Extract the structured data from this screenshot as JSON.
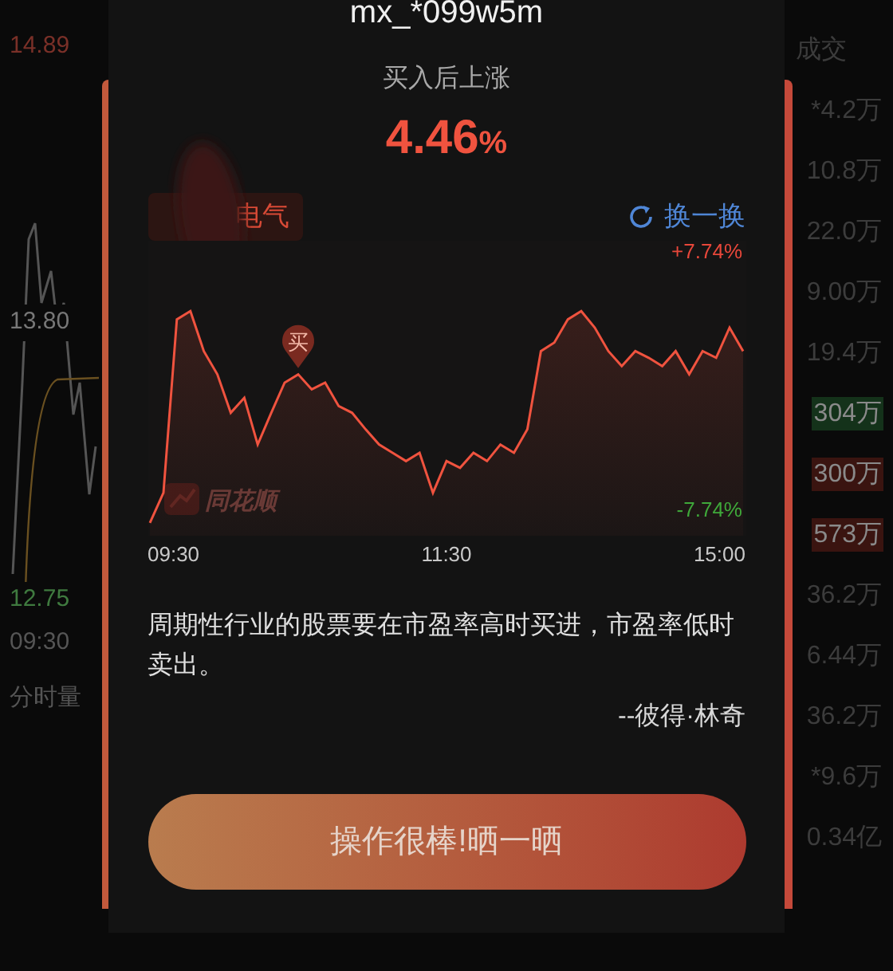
{
  "background": {
    "left_labels": [
      {
        "text": "14.89",
        "kind": "up"
      },
      {
        "text": "13.80",
        "kind": "flat"
      },
      {
        "text": "12.75",
        "kind": "down"
      },
      {
        "text": "09:30",
        "kind": "time"
      },
      {
        "text": "分时量",
        "kind": "section"
      }
    ],
    "volume_header": "成交",
    "volumes": [
      {
        "text": "*4.2万"
      },
      {
        "text": "10.8万"
      },
      {
        "text": "22.0万"
      },
      {
        "text": "9.00万"
      },
      {
        "text": "19.4万"
      },
      {
        "text": "304万",
        "color": "#14321a"
      },
      {
        "text": "300万",
        "color": "#3a1410"
      },
      {
        "text": "573万",
        "color": "#3a1410"
      },
      {
        "text": "36.2万"
      },
      {
        "text": "6.44万"
      },
      {
        "text": "36.2万"
      },
      {
        "text": "*9.6万"
      },
      {
        "text": "0.34亿"
      }
    ]
  },
  "dialog": {
    "user": "mx_*099w5m",
    "gain_label": "买入后上涨",
    "gain_value": "4.46",
    "gain_unit": "%",
    "stock_tag": "电气",
    "refresh": "换一换",
    "chart_data": {
      "type": "line",
      "series": [
        {
          "color": "#f0533f",
          "values": [
            -8.5,
            -6.7,
            3.7,
            4.2,
            1.8,
            0.4,
            -1.9,
            -1,
            -3.8,
            -1.9,
            -0.1,
            0.4,
            -0.5,
            -0.1,
            -1.5,
            -1.9,
            -2.9,
            -3.8,
            -4.3,
            -4.8,
            -4.3,
            -6.7,
            -4.8,
            -5.2,
            -4.3,
            -4.8,
            -3.8,
            -4.3,
            -2.9,
            1.8,
            2.3,
            3.7,
            4.2,
            3.2,
            1.8,
            0.9,
            1.8,
            1.4,
            0.9,
            1.8,
            0.4,
            1.8,
            1.4,
            3.2,
            1.8
          ]
        }
      ],
      "ylim": [
        -9.27,
        8.41
      ],
      "yticks": [
        {
          "value": 7.74,
          "label": "+7.74%"
        },
        {
          "value": -7.74,
          "label": "-7.74%"
        }
      ]
    },
    "time_labels": [
      "09:30",
      "11:30",
      "15:00"
    ],
    "buy_marker": "买",
    "chart_watermark": "同花顺",
    "quote": "周期性行业的股票要在市盈率高时买进，市盈率低时卖出。",
    "author": "--彼得·林奇",
    "share_button": "操作很棒!晒一晒"
  }
}
